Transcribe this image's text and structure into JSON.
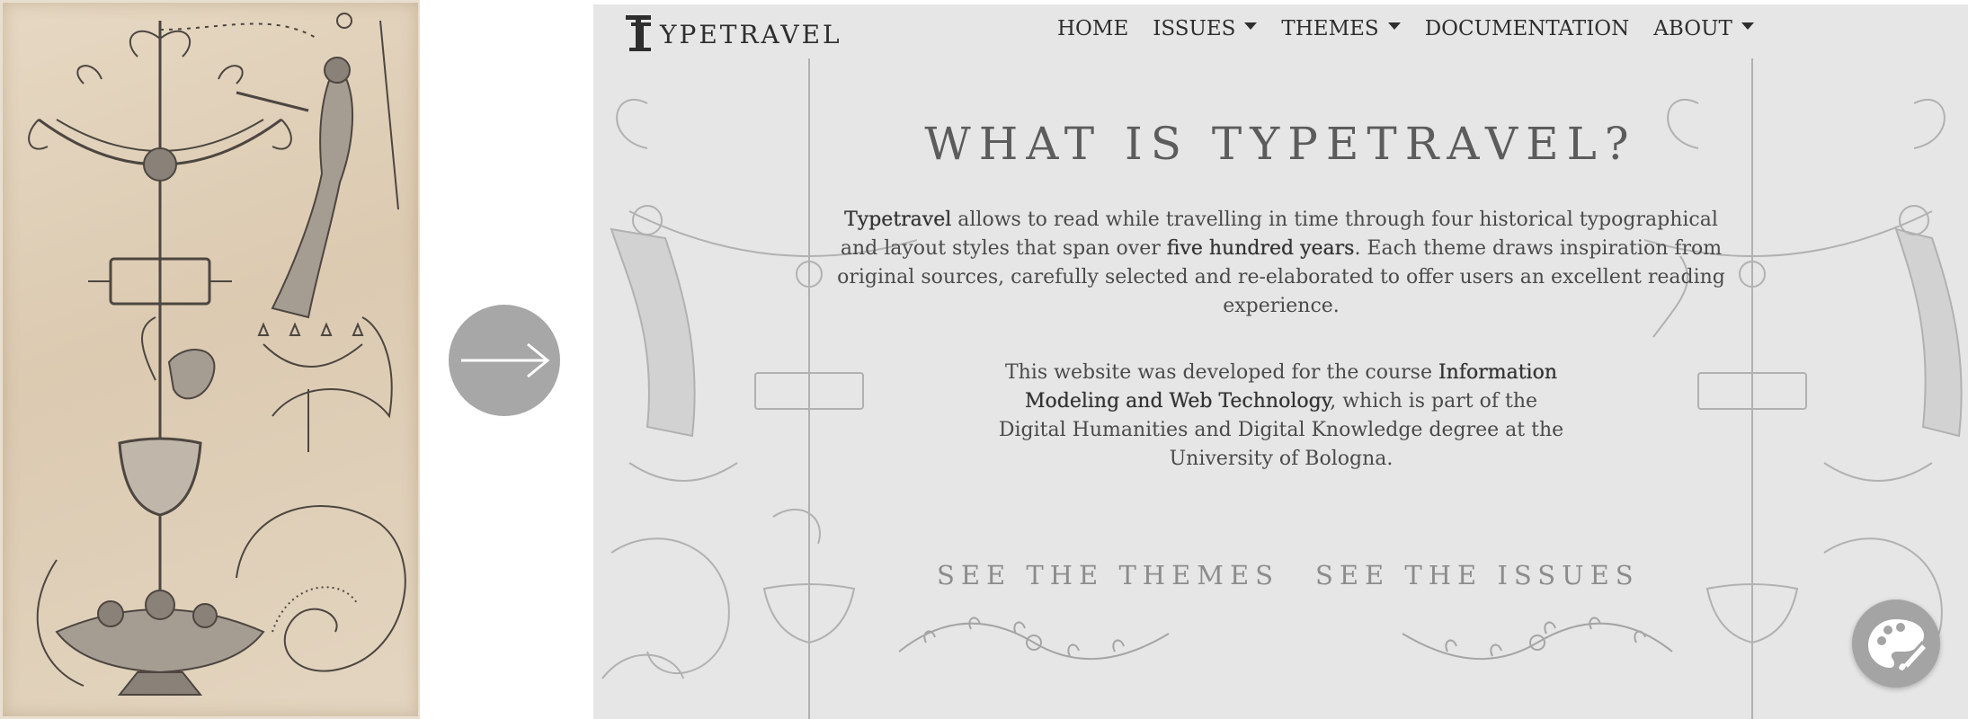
{
  "source_image": {
    "arrow_icon": "arrow-right-icon"
  },
  "site": {
    "brand": {
      "mark_icon": "typetravel-logo-icon",
      "name": "YPETRAVEL"
    },
    "nav": {
      "items": [
        {
          "label": "HOME",
          "dropdown": false
        },
        {
          "label": "ISSUES",
          "dropdown": true
        },
        {
          "label": "THEMES",
          "dropdown": true
        },
        {
          "label": "DOCUMENTATION",
          "dropdown": false
        },
        {
          "label": "ABOUT",
          "dropdown": true
        }
      ],
      "dropdown_icon": "caret-down-icon"
    },
    "hero": {
      "title": "WHAT IS TYPETRAVEL?",
      "intro": {
        "strong_1": "Typetravel",
        "text_1": " allows to read while travelling in time through four historical typographical and layout styles that span over ",
        "strong_2": "five hundred years",
        "text_2": ". Each theme draws inspiration from original sources, carefully selected and re-elaborated to offer users an excellent reading experience."
      },
      "course": {
        "text_1": "This website was developed for the course ",
        "strong_1": "Information Modeling and Web Technology",
        "text_2": ", which is part of the Digital Humanities and Digital Knowledge degree at the University of Bologna."
      }
    },
    "actions": {
      "themes_label": "SEE THE THEMES",
      "issues_label": "SEE THE ISSUES"
    },
    "palette_button_icon": "palette-brush-icon",
    "colors": {
      "background": "#e6e6e6",
      "text": "#2e2e2e",
      "title": "#5c5c5c",
      "cta": "#8c8c8c"
    }
  }
}
